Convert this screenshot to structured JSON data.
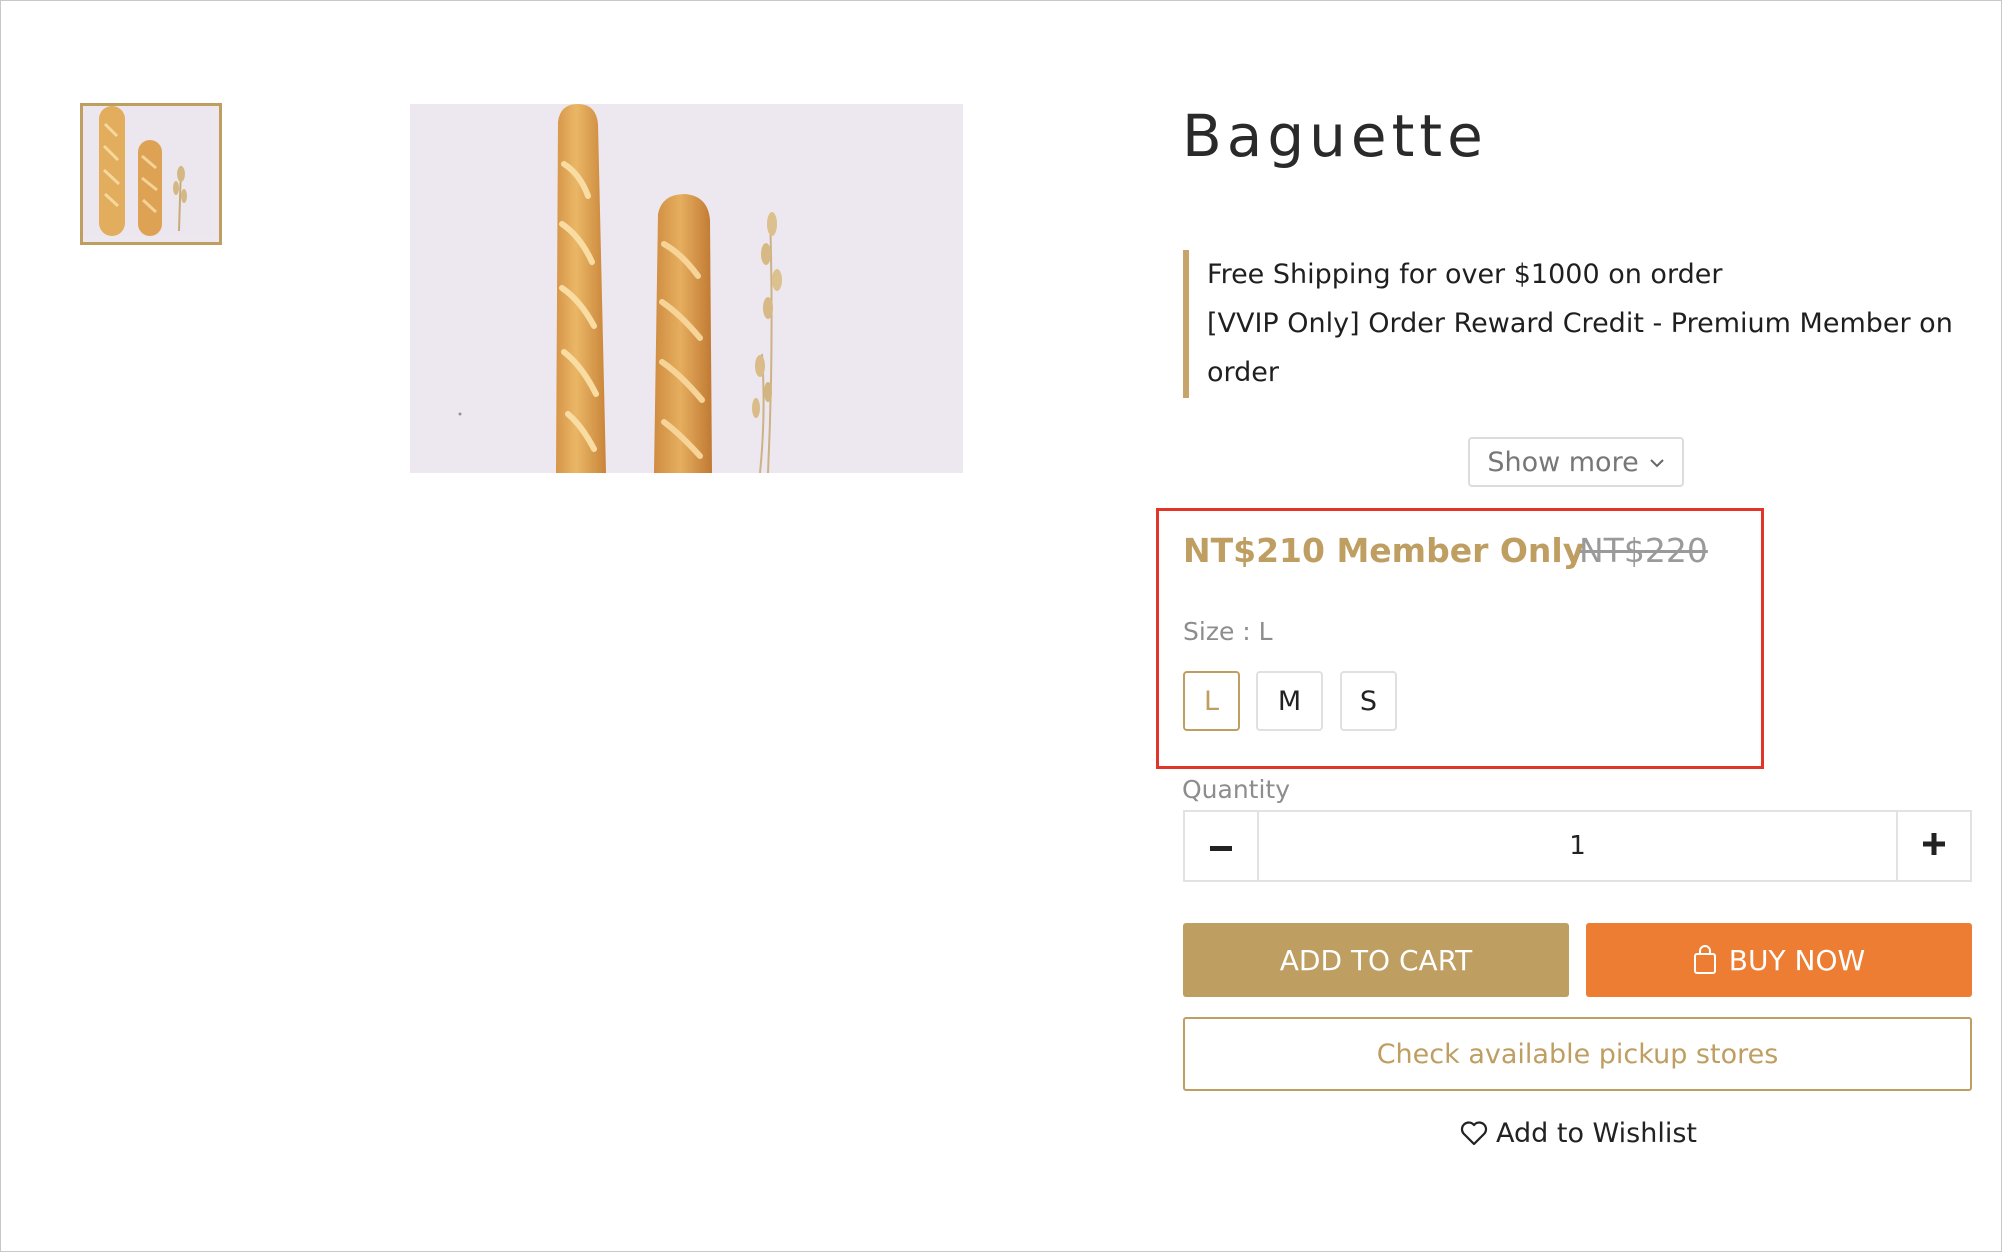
{
  "product": {
    "title": "Baguette",
    "promotions": [
      "Free Shipping for over $1000 on order",
      "[VVIP Only] Order Reward Credit - Premium Member on",
      "order"
    ],
    "show_more_label": "Show more",
    "price": "NT$210 Member Only",
    "original_price": "NT$220",
    "size_label": "Size : L",
    "sizes": [
      "L",
      "M",
      "S"
    ],
    "selected_size": "L",
    "quantity_label": "Quantity",
    "quantity_value": "1",
    "add_to_cart_label": "ADD TO CART",
    "buy_now_label": "BUY NOW",
    "pickup_label": "Check available pickup stores",
    "wishlist_label": "Add to Wishlist"
  },
  "images": {
    "thumbnail": "baguette-thumbnail",
    "main": "baguette-photo"
  },
  "icons": {
    "show_more": "chevron-down-icon",
    "quantity_decrease": "minus-icon",
    "quantity_increase": "plus-icon",
    "buy_now": "shopping-bag-icon",
    "wishlist": "heart-icon"
  },
  "colors": {
    "accent_gold": "#bf9e62",
    "buy_now_orange": "#ec7d33",
    "highlight_red": "#e2352a",
    "old_price_gray": "#9a9a9a"
  }
}
